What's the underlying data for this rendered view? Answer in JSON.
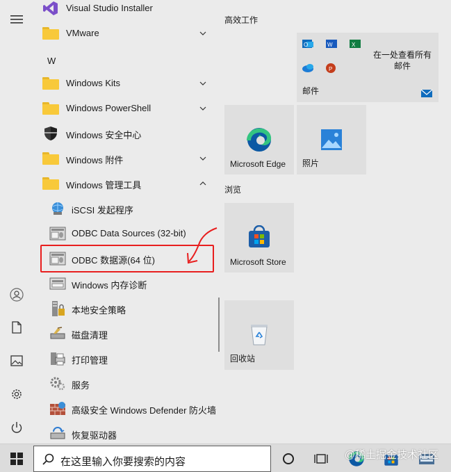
{
  "app_list": {
    "items": [
      {
        "label": "Visual Studio Installer",
        "icon": "visual-studio-icon"
      },
      {
        "label": "VMware",
        "icon": "folder-icon"
      },
      {
        "label": "Windows Kits",
        "icon": "folder-icon"
      },
      {
        "label": "Windows PowerShell",
        "icon": "folder-icon"
      },
      {
        "label": "Windows 安全中心",
        "icon": "shield-icon"
      },
      {
        "label": "Windows 附件",
        "icon": "folder-icon"
      },
      {
        "label": "Windows 管理工具",
        "icon": "folder-icon"
      }
    ],
    "letter": "W",
    "sub_items": [
      {
        "label": "iSCSI 发起程序",
        "icon": "iscsi-icon"
      },
      {
        "label": "ODBC Data Sources (32-bit)",
        "icon": "odbc-icon"
      },
      {
        "label": "ODBC 数据源(64 位)",
        "icon": "odbc-icon"
      },
      {
        "label": "Windows 内存诊断",
        "icon": "memory-diagnostic-icon"
      },
      {
        "label": "本地安全策略",
        "icon": "security-policy-icon"
      },
      {
        "label": "磁盘清理",
        "icon": "disk-cleanup-icon"
      },
      {
        "label": "打印管理",
        "icon": "print-management-icon"
      },
      {
        "label": "服务",
        "icon": "services-icon"
      },
      {
        "label": "高级安全 Windows Defender 防火墙",
        "icon": "firewall-icon"
      },
      {
        "label": "恢复驱动器",
        "icon": "recovery-drive-icon"
      }
    ]
  },
  "tiles": {
    "group1_title": "高效工作",
    "group2_title": "浏览",
    "office_tile_text": "在一处查看所有邮件",
    "mail_label": "邮件",
    "edge_label": "Microsoft Edge",
    "photos_label": "照片",
    "store_label": "Microsoft Store",
    "recycle_label": "回收站"
  },
  "taskbar": {
    "search_placeholder": "在这里输入你要搜索的内容",
    "watermark": "@稀土掘金技术社区"
  },
  "colors": {
    "highlight": "#e81e1e",
    "folder": "#f8c93a",
    "tile_bg": "#dfdfdf"
  }
}
